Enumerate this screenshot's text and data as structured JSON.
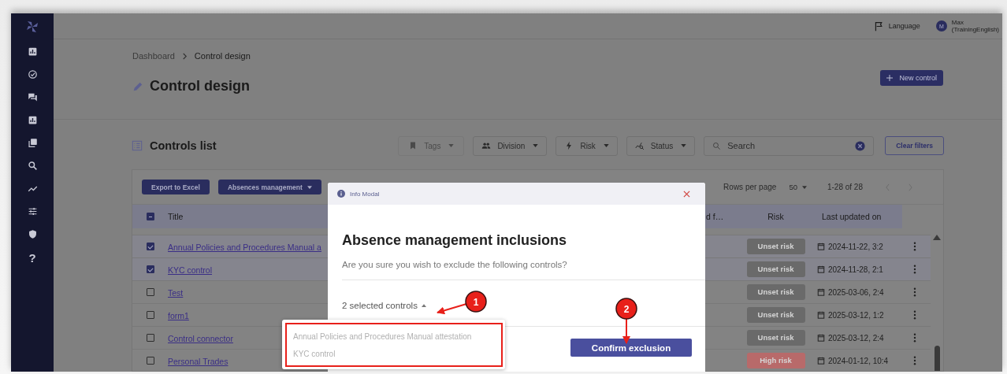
{
  "header": {
    "language": "Language",
    "user_initial": "M",
    "user_name": "Max",
    "user_org": "(TrainingEnglish)"
  },
  "sidebar": {
    "help": "?"
  },
  "breadcrumb": [
    {
      "label": "Dashboard",
      "current": false
    },
    {
      "label": "Control design",
      "current": true
    }
  ],
  "page_title": "Control design",
  "new_button": "New control",
  "list_title": "Controls list",
  "filters": [
    {
      "kind": "tags",
      "label": "Tags",
      "disabled": true
    },
    {
      "kind": "division",
      "label": "Division",
      "disabled": false
    },
    {
      "kind": "risk",
      "label": "Risk",
      "disabled": false
    },
    {
      "kind": "status",
      "label": "Status",
      "disabled": false
    }
  ],
  "search": {
    "placeholder": "Search"
  },
  "clear_filters": "Clear filters",
  "toolbar": {
    "export": "Export to Excel",
    "absences": "Absences management",
    "rows_per_page": "Rows per page",
    "page_size": "50",
    "range": "1-28 of 28"
  },
  "table": {
    "header_indeterminate": true,
    "columns": [
      {
        "label": "Title"
      },
      {
        "label": "d f…"
      },
      {
        "label": "Risk"
      },
      {
        "label": "Last updated on"
      }
    ],
    "rows": [
      {
        "title": "Annual Policies and Procedures Manual a",
        "checked": true,
        "risk": "Unset risk",
        "color": "#6a6a6a",
        "updated": "2024-11-22, 3:2"
      },
      {
        "title": "KYC control",
        "checked": true,
        "risk": "Unset risk",
        "color": "#6a6a6a",
        "updated": "2024-11-28, 2:1"
      },
      {
        "title": "Test",
        "checked": false,
        "risk": "Unset risk",
        "color": "#6a6a6a",
        "updated": "2025-03-06, 2:4"
      },
      {
        "title": "form1",
        "checked": false,
        "risk": "Unset risk",
        "color": "#6a6a6a",
        "updated": "2025-03-12, 1:2"
      },
      {
        "title": "Control connector",
        "checked": false,
        "risk": "Unset risk",
        "color": "#6a6a6a",
        "updated": "2025-03-12, 2:4"
      },
      {
        "title": "Personal Trades",
        "checked": false,
        "risk": "High risk",
        "color": "#b86a6a",
        "updated": "2024-01-12, 10:4"
      }
    ]
  },
  "modal": {
    "header": "Info Modal",
    "title": "Absence management inclusions",
    "message": "Are you sure you wish to exclude the following controls?",
    "selected": "2 selected controls",
    "expanded": true,
    "items": [
      "Annual Policies and Procedures Manual attestation",
      "KYC control"
    ],
    "confirm": "Confirm exclusion"
  },
  "annotations": [
    {
      "number": "1"
    },
    {
      "number": "2"
    }
  ]
}
